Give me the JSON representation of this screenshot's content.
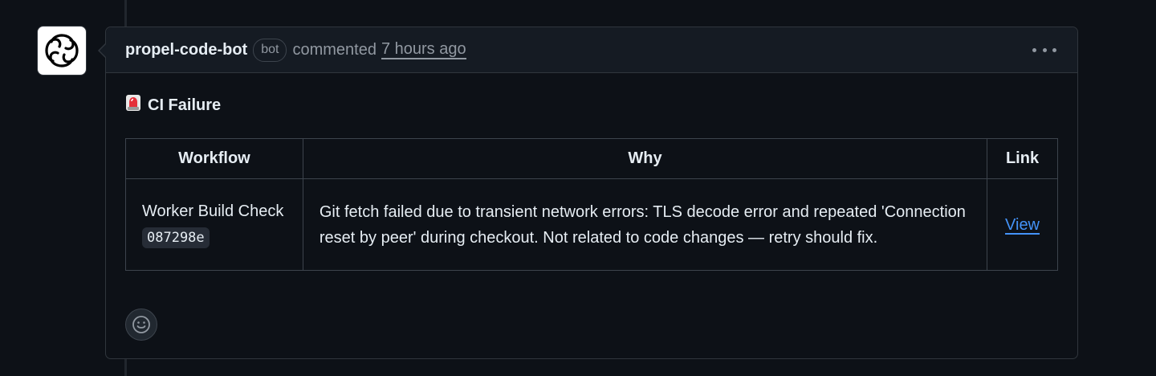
{
  "comment": {
    "author": "propel-code-bot",
    "author_badge": "bot",
    "action": "commented",
    "timestamp": "7 hours ago"
  },
  "body": {
    "heading_emoji": "🚨",
    "heading": "CI Failure",
    "table": {
      "headers": [
        "Workflow",
        "Why",
        "Link"
      ],
      "rows": [
        {
          "workflow": "Worker Build Check",
          "commit": "087298e",
          "why": "Git fetch failed due to transient network errors: TLS decode error and repeated 'Connection reset by peer' during checkout. Not related to code changes — retry should fix.",
          "link": "View"
        }
      ]
    }
  },
  "icons": {
    "avatar": "propel-logo-icon",
    "more": "kebab-horizontal-icon",
    "reaction": "smiley-icon"
  },
  "colors": {
    "background": "#0d1117",
    "header_bg": "#151b23",
    "border": "#30363d",
    "muted_text": "#9198a1",
    "link": "#4493f8"
  }
}
